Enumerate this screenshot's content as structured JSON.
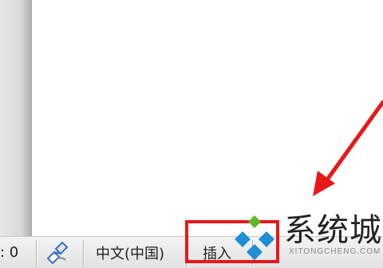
{
  "status_bar": {
    "word_count": ": 0",
    "language": "中文(中国)",
    "insert_mode": "插入"
  },
  "watermark": {
    "title": "系统城",
    "subtitle": "XITONGCHENG.COM"
  },
  "colors": {
    "highlight": "#e81818",
    "logo_green": "#5db82b",
    "logo_blue": "#1f8fd6"
  },
  "icons": [
    "language-proofing-icon",
    "red-arrow-icon"
  ]
}
